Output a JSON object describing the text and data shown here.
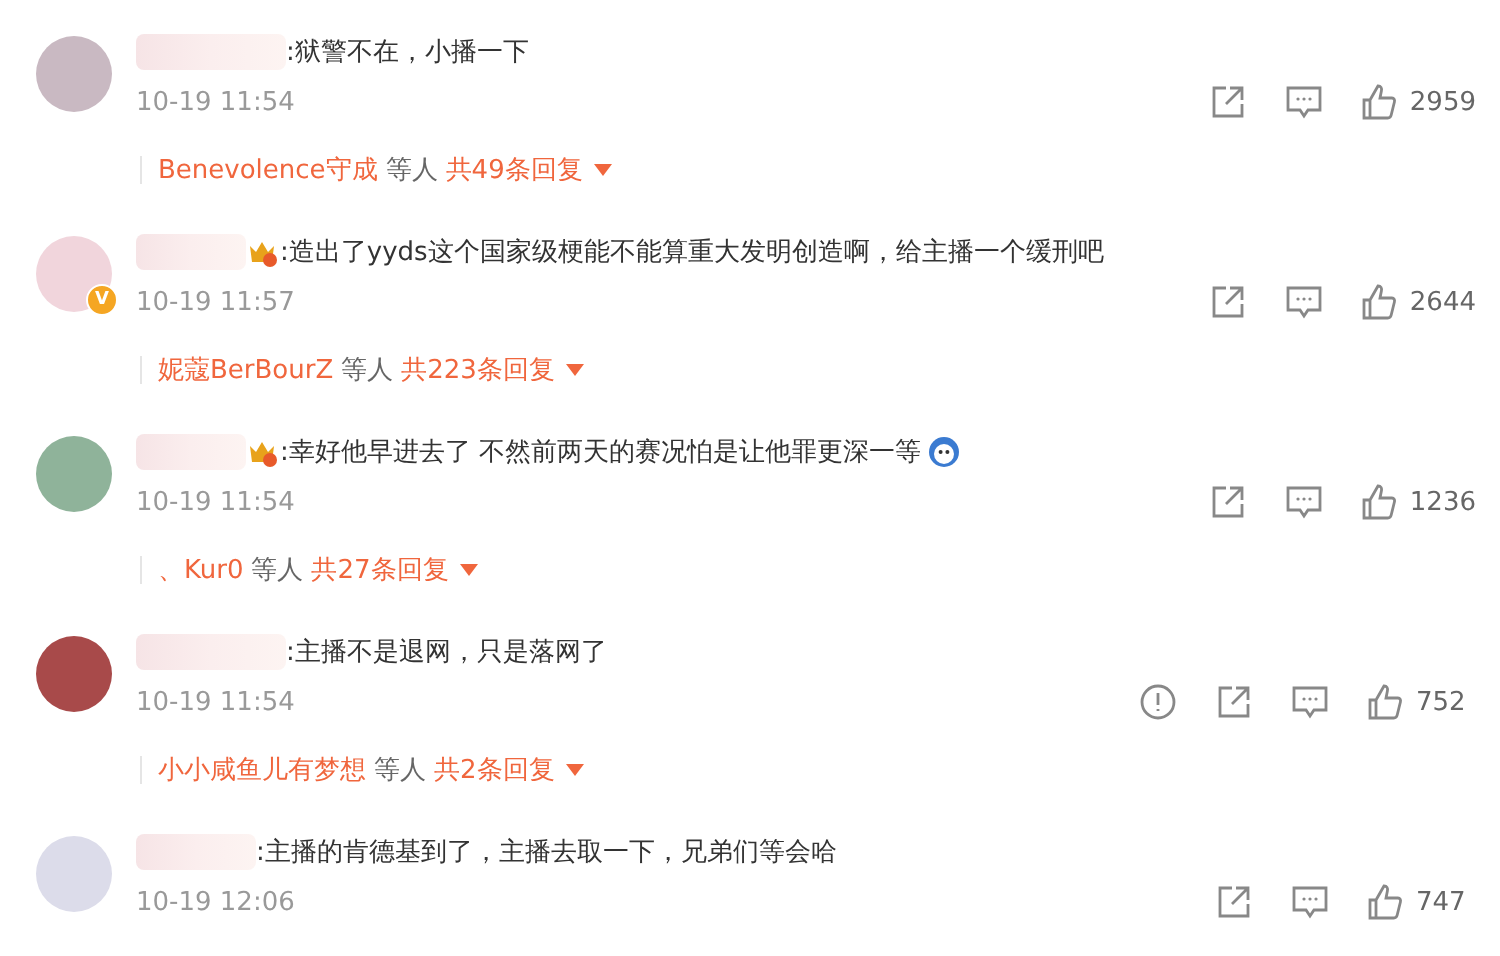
{
  "comments": [
    {
      "crown_badge": false,
      "text": ":狱警不在，小播一下",
      "emoji": false,
      "time": "10-19 11:54",
      "report_visible": false,
      "likes": "2959",
      "replies": {
        "name": "Benevolence守成",
        "others": "等人",
        "count": "共49条回复"
      }
    },
    {
      "crown_badge": true,
      "verified_badge": "V",
      "text": ":造出了yyds这个国家级梗能不能算重大发明创造啊，给主播一个缓刑吧",
      "emoji": false,
      "time": "10-19 11:57",
      "report_visible": false,
      "likes": "2644",
      "replies": {
        "name": "妮蔻BerBourZ",
        "others": "等人",
        "count": "共223条回复"
      }
    },
    {
      "crown_badge": true,
      "text": ":幸好他早进去了 不然前两天的赛况怕是让他罪更深一等",
      "emoji": true,
      "time": "10-19 11:54",
      "report_visible": false,
      "likes": "1236",
      "replies": {
        "name": "、Kur0",
        "others": "等人",
        "count": "共27条回复"
      }
    },
    {
      "crown_badge": false,
      "text": ":主播不是退网，只是落网了",
      "emoji": false,
      "time": "10-19 11:54",
      "report_visible": true,
      "likes": "752",
      "replies": {
        "name": "小小咸鱼儿有梦想",
        "others": "等人",
        "count": "共2条回复"
      }
    },
    {
      "crown_badge": false,
      "text": ":主播的肯德基到了，主播去取一下，兄弟们等会哈",
      "emoji": false,
      "time": "10-19 12:06",
      "report_visible": false,
      "likes": "747"
    }
  ]
}
